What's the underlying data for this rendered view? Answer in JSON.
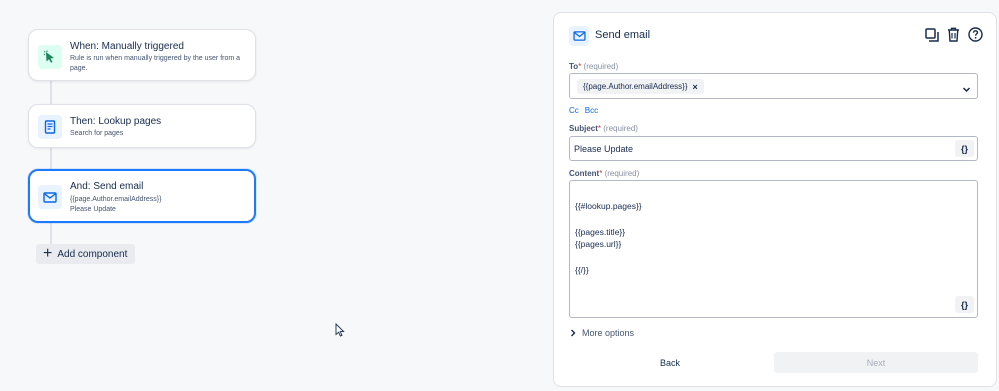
{
  "flow": {
    "trigger": {
      "title": "When: Manually triggered",
      "description": "Rule is run when manually triggered by the user from a page."
    },
    "lookup": {
      "title": "Then: Lookup pages",
      "description": "Search for pages"
    },
    "send_email": {
      "title": "And: Send email",
      "line1": "{{page.Author.emailAddress}}",
      "line2": "Please Update"
    },
    "add_component_label": "Add component"
  },
  "panel": {
    "title": "Send email",
    "to": {
      "label": "To",
      "required_mark": "*",
      "hint": "(required)",
      "chip": "{{page.Author.emailAddress}}"
    },
    "cc_label": "Cc",
    "bcc_label": "Bcc",
    "subject": {
      "label": "Subject",
      "required_mark": "*",
      "hint": "(required)",
      "value": "Please Update"
    },
    "content": {
      "label": "Content",
      "required_mark": "*",
      "hint": "(required)",
      "value": "{{#lookup.pages}}\n\n{{pages.title}}\n{{pages.url}}\n\n{{/}}"
    },
    "brace_label": "{}",
    "more_options": "More options",
    "back_label": "Back",
    "next_label": "Next"
  },
  "icons": {
    "trigger": "cursor-click-icon",
    "lookup": "page-icon",
    "email": "envelope-icon",
    "duplicate": "copy-icon",
    "delete": "trash-icon",
    "help": "question-icon"
  },
  "colors": {
    "accent": "#1d7afc",
    "link": "#0c66e4",
    "required": "#c9372c",
    "trigger_icon": "#1f845a"
  }
}
